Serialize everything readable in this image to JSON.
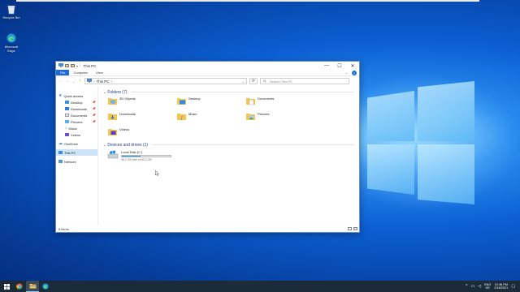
{
  "desktop": {
    "icons": [
      {
        "label": "Recycle Bin",
        "icon": "recycle-bin-icon"
      },
      {
        "label": "Microsoft Edge",
        "icon": "edge-icon"
      }
    ]
  },
  "window": {
    "title": "This PC",
    "controls": {
      "minimize": "—",
      "maximize": "☐",
      "close": "✕"
    },
    "ribbon_tabs": [
      "File",
      "Computer",
      "View"
    ],
    "help": "?",
    "address": {
      "icon": "computer-icon",
      "path": "This PC",
      "separator": "›"
    },
    "search_placeholder": "Search This PC",
    "nav": {
      "quick_access": "Quick access",
      "pinned": [
        {
          "label": "Desktop",
          "icon": "desktop-folder-icon"
        },
        {
          "label": "Downloads",
          "icon": "downloads-folder-icon"
        },
        {
          "label": "Documents",
          "icon": "documents-folder-icon"
        },
        {
          "label": "Pictures",
          "icon": "pictures-folder-icon"
        },
        {
          "label": "Music",
          "icon": "music-folder-icon"
        },
        {
          "label": "Videos",
          "icon": "videos-folder-icon"
        }
      ],
      "onedrive": "OneDrive",
      "this_pc": "This PC",
      "network": "Network"
    },
    "folders_header": "Folders (7)",
    "folders": [
      {
        "name": "3D Objects",
        "icon": "3d-objects-folder-icon"
      },
      {
        "name": "Desktop",
        "icon": "desktop-folder-icon"
      },
      {
        "name": "Documents",
        "icon": "documents-folder-icon"
      },
      {
        "name": "Downloads",
        "icon": "downloads-folder-icon"
      },
      {
        "name": "Music",
        "icon": "music-folder-icon"
      },
      {
        "name": "Pictures",
        "icon": "pictures-folder-icon"
      },
      {
        "name": "Videos",
        "icon": "videos-folder-icon"
      }
    ],
    "drives_header": "Devices and drives (1)",
    "drive": {
      "name": "Local Disk (C:)",
      "free": "36.2 GB free of 59.2 GB",
      "used_fraction": 0.39
    },
    "status": "8 items"
  },
  "taskbar": {
    "apps": [
      "windows-start-icon",
      "chrome-icon",
      "file-explorer-icon",
      "edge-icon"
    ],
    "tray": {
      "lang_top": "ENG",
      "lang_bottom": "DE",
      "time": "12:46 PM",
      "date": "2/16/2021"
    }
  },
  "colors": {
    "accent": "#1e6ccf",
    "taskbar": "#1c2b3a",
    "drive_bar": "#26a0da"
  }
}
